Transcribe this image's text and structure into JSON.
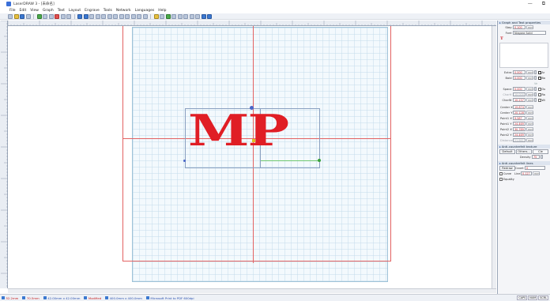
{
  "window": {
    "title": "LaserDRAW 3 - [未命名]",
    "controls": [
      "—",
      "⧉"
    ]
  },
  "menu": [
    "File",
    "Edit",
    "View",
    "Graph",
    "Text",
    "Layout",
    "Engrave",
    "Tools",
    "Network",
    "Languages",
    "Help"
  ],
  "canvas": {
    "text": "MP",
    "text_color": "#e01e25",
    "outline_color": "#e36262"
  },
  "status": {
    "x": "52.2mm",
    "y": "70.5mm",
    "size": "42.00mm x 42.00mm",
    "modified": "Modified",
    "bed": "400.0mm x 400.0mm",
    "printer": "Microsoft Print to PDF 600dpi",
    "indicators": [
      "CAPS",
      "NUM",
      "SCRL"
    ]
  },
  "panel": {
    "section_text": "Graph and Text properties",
    "step_label": "Step",
    "step_value": "0.100",
    "step_unit": "mm",
    "font_label": "Font",
    "font_value": "Niagara Solid",
    "extra_label": "Extra",
    "extra_value": "0.000",
    "bold_label": "Bold",
    "bold_value": "0.000",
    "space_label": "Space",
    "space_value": "0.000",
    "charh_label": "CharH",
    "charh_value": "10.000",
    "charw_label": "CharW",
    "charw_value": "10.237",
    "unit": "mm",
    "check_labels": [
      "Ar",
      "Bo",
      "Ve",
      "Ou",
      "Ra",
      "Wi"
    ],
    "center_x_label": "Center X",
    "center_x_value": "19.874",
    "center_y_label": "Center Y",
    "center_y_value": "20.128",
    "point1x_label": "Point1 X",
    "point1x_value": "9.587",
    "point1y_label": "Point1 Y",
    "point1y_value": "24.469",
    "point2x_label": "Point2 X",
    "point2x_value": "30.789",
    "point2y_label": "Point2 Y",
    "point2y_value": "24.469",
    "distance_label": "Distance",
    "distance_value": "21.861",
    "anti_section": "Anti-counterfeit texture",
    "default_btn": "Default",
    "others_btn": "Others...",
    "clear_btn": "Cle",
    "density_label": "Density",
    "density_value": "75",
    "anti_lines_section": "Anti-counterfeit lines",
    "redraw_btn": "Redraw",
    "count_label": "Count",
    "count_value": "0",
    "curve_label": "Curve",
    "line_label": "Line",
    "line_value": "0.127",
    "equality_label": "Equality"
  },
  "icons": {
    "toolbar": [
      "new-icon",
      "open-icon",
      "save-icon",
      "print-icon",
      "cut-icon",
      "copy-icon",
      "paste-icon",
      "delete-icon",
      "undo-icon",
      "redo-icon",
      "zoom-in-icon",
      "zoom-out-icon",
      "select-icon",
      "line-icon",
      "rect-icon",
      "ellipse-icon",
      "text-icon",
      "engrave-icon",
      "cut-laser-icon"
    ]
  }
}
